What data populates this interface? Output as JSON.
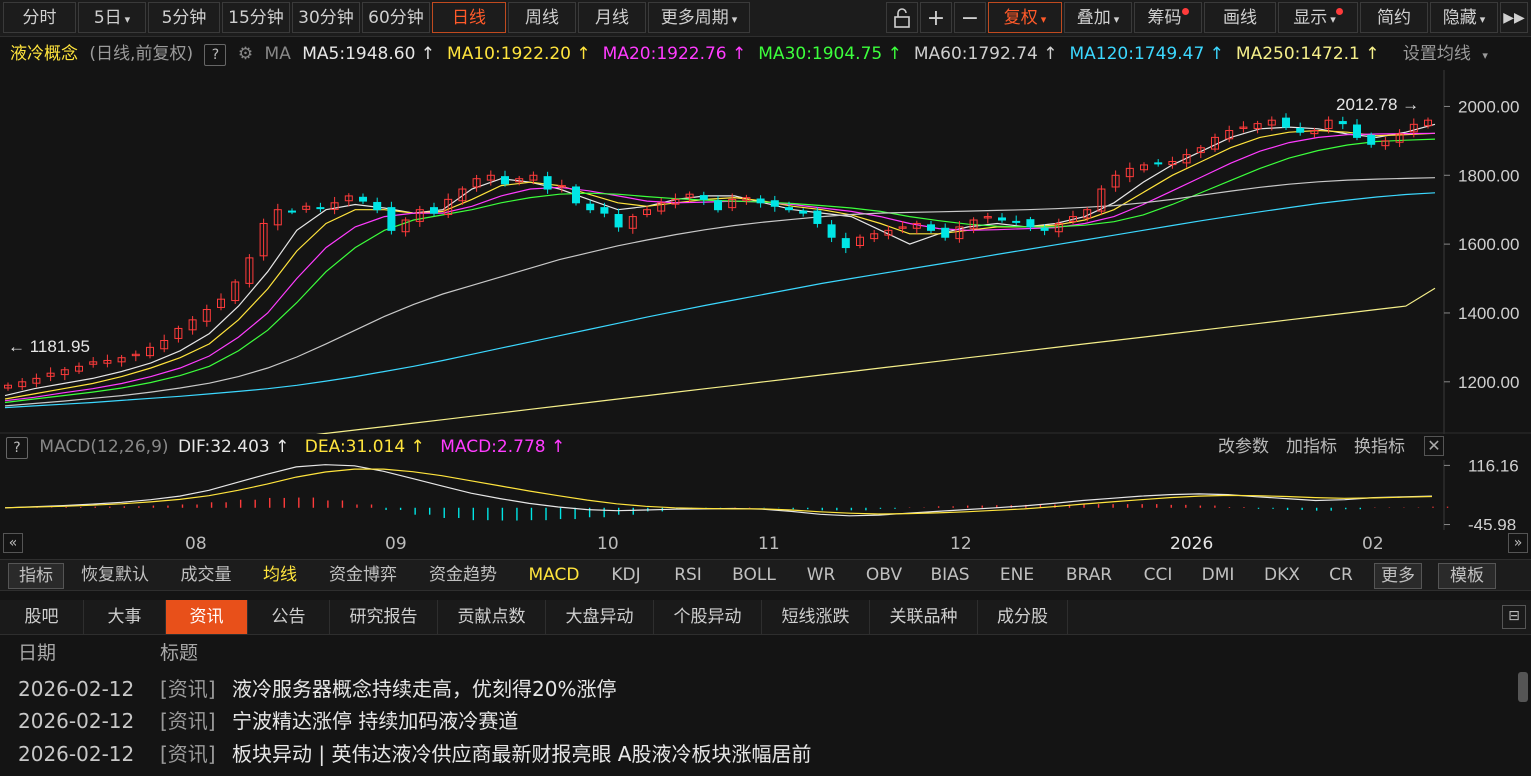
{
  "toolbar": {
    "periods": [
      "分时",
      "5日",
      "5分钟",
      "15分钟",
      "30分钟",
      "60分钟",
      "日线",
      "周线",
      "月线",
      "更多周期"
    ],
    "active_period": "日线",
    "tools": [
      "复权",
      "叠加",
      "筹码",
      "画线",
      "显示",
      "简约",
      "隐藏"
    ]
  },
  "ma_bar": {
    "name": "液冷概念",
    "mode": "(日线,前复权)",
    "help": "?",
    "ma_label": "MA",
    "items": [
      {
        "text": "MA5:1948.60",
        "color": "#e6e6e6"
      },
      {
        "text": "MA10:1922.20",
        "color": "#ffe43d"
      },
      {
        "text": "MA20:1922.76",
        "color": "#ff3cff"
      },
      {
        "text": "MA30:1904.75",
        "color": "#3cff3c"
      },
      {
        "text": "MA60:1792.74",
        "color": "#cfcfcf"
      },
      {
        "text": "MA120:1749.47",
        "color": "#3cd8ff"
      },
      {
        "text": "MA250:1472.1",
        "color": "#f5ef8a"
      }
    ],
    "settings": "设置均线"
  },
  "chart_data": {
    "type": "candlestick",
    "x_labels": [
      "08",
      "09",
      "10",
      "11",
      "12",
      "2026",
      "02"
    ],
    "y_ticks": [
      "2000.00",
      "1800.00",
      "1600.00",
      "1400.00",
      "1200.00"
    ],
    "ylim": [
      1060,
      2100
    ],
    "high_label": "2012.78",
    "low_label": "1181.95",
    "closes": [
      1190,
      1200,
      1210,
      1225,
      1235,
      1245,
      1258,
      1262,
      1270,
      1280,
      1300,
      1320,
      1355,
      1380,
      1410,
      1440,
      1490,
      1560,
      1660,
      1700,
      1695,
      1710,
      1705,
      1720,
      1740,
      1725,
      1700,
      1640,
      1670,
      1700,
      1690,
      1730,
      1760,
      1790,
      1800,
      1775,
      1790,
      1800,
      1760,
      1770,
      1720,
      1700,
      1690,
      1650,
      1680,
      1700,
      1720,
      1730,
      1745,
      1730,
      1700,
      1730,
      1735,
      1720,
      1710,
      1700,
      1690,
      1660,
      1620,
      1590,
      1620,
      1630,
      1640,
      1650,
      1660,
      1640,
      1620,
      1650,
      1670,
      1680,
      1670,
      1665,
      1650,
      1640,
      1660,
      1680,
      1700,
      1760,
      1800,
      1820,
      1830,
      1835,
      1840,
      1860,
      1880,
      1910,
      1930,
      1940,
      1950,
      1960,
      1940,
      1925,
      1930,
      1960,
      1950,
      1910,
      1890,
      1900,
      1920,
      1948,
      1960
    ],
    "ma": [
      {
        "name": "MA5",
        "color": "#e6e6e6",
        "values": [
          1160,
          1180,
          1195,
          1210,
          1230,
          1255,
          1290,
          1340,
          1420,
          1520,
          1640,
          1700,
          1715,
          1705,
          1690,
          1700,
          1760,
          1790,
          1780,
          1760,
          1730,
          1700,
          1710,
          1730,
          1740,
          1740,
          1720,
          1700,
          1690,
          1680,
          1640,
          1600,
          1630,
          1650,
          1660,
          1650,
          1660,
          1680,
          1720,
          1780,
          1830,
          1870,
          1910,
          1935,
          1940,
          1935,
          1920,
          1910,
          1925,
          1948
        ]
      },
      {
        "name": "MA10",
        "color": "#ffe43d",
        "values": [
          1150,
          1165,
          1180,
          1195,
          1215,
          1240,
          1270,
          1310,
          1380,
          1470,
          1580,
          1660,
          1700,
          1700,
          1690,
          1695,
          1730,
          1770,
          1780,
          1770,
          1745,
          1720,
          1710,
          1720,
          1730,
          1735,
          1725,
          1710,
          1700,
          1685,
          1660,
          1630,
          1630,
          1640,
          1650,
          1650,
          1655,
          1670,
          1700,
          1750,
          1800,
          1840,
          1880,
          1910,
          1925,
          1930,
          1925,
          1915,
          1918,
          1922
        ]
      },
      {
        "name": "MA20",
        "color": "#ff3cff",
        "values": [
          1145,
          1155,
          1168,
          1180,
          1195,
          1215,
          1240,
          1275,
          1330,
          1400,
          1500,
          1590,
          1650,
          1680,
          1690,
          1690,
          1710,
          1740,
          1760,
          1765,
          1755,
          1740,
          1725,
          1720,
          1722,
          1725,
          1722,
          1715,
          1705,
          1695,
          1680,
          1660,
          1645,
          1640,
          1642,
          1645,
          1648,
          1660,
          1680,
          1715,
          1755,
          1795,
          1835,
          1870,
          1895,
          1910,
          1918,
          1920,
          1921,
          1922
        ]
      },
      {
        "name": "MA30",
        "color": "#3cff3c",
        "values": [
          1140,
          1150,
          1160,
          1170,
          1182,
          1198,
          1218,
          1245,
          1290,
          1350,
          1430,
          1520,
          1590,
          1640,
          1670,
          1685,
          1700,
          1720,
          1735,
          1745,
          1748,
          1745,
          1738,
          1732,
          1728,
          1725,
          1722,
          1718,
          1712,
          1705,
          1695,
          1680,
          1668,
          1658,
          1652,
          1650,
          1650,
          1655,
          1665,
          1685,
          1715,
          1750,
          1785,
          1820,
          1850,
          1872,
          1888,
          1898,
          1902,
          1905
        ]
      },
      {
        "name": "MA60",
        "color": "#c8c8c8",
        "values": [
          1130,
          1137,
          1144,
          1152,
          1160,
          1170,
          1182,
          1196,
          1215,
          1240,
          1272,
          1310,
          1350,
          1390,
          1425,
          1455,
          1480,
          1505,
          1530,
          1555,
          1575,
          1595,
          1612,
          1628,
          1642,
          1654,
          1664,
          1672,
          1680,
          1686,
          1690,
          1692,
          1694,
          1696,
          1698,
          1700,
          1703,
          1707,
          1712,
          1720,
          1730,
          1742,
          1754,
          1765,
          1774,
          1781,
          1786,
          1789,
          1791,
          1793
        ]
      },
      {
        "name": "MA120",
        "color": "#3cd8ff",
        "values": [
          1125,
          1130,
          1135,
          1140,
          1146,
          1152,
          1158,
          1165,
          1172,
          1180,
          1190,
          1202,
          1215,
          1230,
          1245,
          1262,
          1280,
          1298,
          1316,
          1334,
          1352,
          1370,
          1388,
          1405,
          1422,
          1438,
          1454,
          1470,
          1486,
          1500,
          1514,
          1528,
          1542,
          1556,
          1570,
          1584,
          1598,
          1612,
          1626,
          1640,
          1654,
          1668,
          1681,
          1694,
          1706,
          1718,
          1728,
          1737,
          1744,
          1749
        ]
      },
      {
        "name": "MA250",
        "color": "#f5ef8a",
        "values": [
          940,
          950,
          960,
          970,
          980,
          990,
          1000,
          1010,
          1020,
          1030,
          1040,
          1050,
          1060,
          1070,
          1080,
          1090,
          1100,
          1110,
          1120,
          1130,
          1140,
          1150,
          1160,
          1170,
          1180,
          1190,
          1200,
          1210,
          1220,
          1230,
          1240,
          1250,
          1260,
          1270,
          1280,
          1290,
          1300,
          1310,
          1320,
          1330,
          1340,
          1350,
          1360,
          1370,
          1380,
          1390,
          1400,
          1410,
          1420,
          1472
        ]
      }
    ],
    "macd": {
      "label": "MACD(12,26,9)",
      "dif": "DIF:32.403",
      "dea": "DEA:31.014",
      "macd": "MACD:2.778",
      "ticks": [
        "116.16",
        "-45.98"
      ],
      "ylim": [
        -50,
        120
      ],
      "dif_values": [
        0,
        3,
        6,
        10,
        15,
        22,
        32,
        48,
        70,
        92,
        112,
        118,
        115,
        100,
        80,
        60,
        40,
        25,
        12,
        2,
        -5,
        -8,
        -6,
        -4,
        -3,
        -2,
        -4,
        -10,
        -18,
        -22,
        -20,
        -15,
        -10,
        -5,
        0,
        5,
        12,
        20,
        26,
        32,
        36,
        38,
        36,
        30,
        25,
        20,
        22,
        28,
        30,
        32
      ],
      "dea_values": [
        0,
        2,
        4,
        7,
        11,
        16,
        23,
        33,
        48,
        65,
        84,
        98,
        106,
        106,
        99,
        88,
        74,
        60,
        46,
        33,
        21,
        11,
        4,
        0,
        -2,
        -3,
        -3,
        -6,
        -11,
        -15,
        -17,
        -16,
        -14,
        -11,
        -7,
        -3,
        3,
        10,
        16,
        22,
        28,
        32,
        34,
        33,
        31,
        28,
        26,
        27,
        29,
        31
      ],
      "hist": [
        0,
        1,
        2,
        3,
        4,
        6,
        9,
        15,
        22,
        27,
        28,
        20,
        9,
        -6,
        -19,
        -28,
        -34,
        -35,
        -34,
        -31,
        -26,
        -19,
        -10,
        -4,
        -1,
        1,
        -1,
        -4,
        -7,
        -7,
        -3,
        1,
        4,
        6,
        7,
        8,
        9,
        10,
        10,
        10,
        8,
        6,
        2,
        -3,
        -6,
        -8,
        -4,
        1,
        1,
        3
      ]
    }
  },
  "macd_links": [
    "改参数",
    "加指标",
    "换指标"
  ],
  "indicators": {
    "items": [
      "指标",
      "恢复默认",
      "成交量",
      "均线",
      "资金博弈",
      "资金趋势",
      "MACD",
      "KDJ",
      "RSI",
      "BOLL",
      "WR",
      "OBV",
      "BIAS",
      "ENE",
      "BRAR",
      "CCI",
      "DMI",
      "DKX",
      "CR",
      "更多",
      "模板"
    ],
    "highlight": "均线"
  },
  "news_tabs": {
    "items": [
      "股吧",
      "大事",
      "资讯",
      "公告",
      "研究报告",
      "贡献点数",
      "大盘异动",
      "个股异动",
      "短线涨跌",
      "关联品种",
      "成分股"
    ],
    "active": "资讯"
  },
  "news": {
    "col_date": "日期",
    "col_title": "标题",
    "rows": [
      {
        "date": "2026-02-12",
        "tag": "[资讯]",
        "title": "液冷服务器概念持续走高，优刻得20%涨停"
      },
      {
        "date": "2026-02-12",
        "tag": "[资讯]",
        "title": "宁波精达涨停 持续加码液冷赛道"
      },
      {
        "date": "2026-02-12",
        "tag": "[资讯]",
        "title": "板块异动 | 英伟达液冷供应商最新财报亮眼 A股液冷板块涨幅居前"
      }
    ]
  },
  "colors": {
    "up": "#ff3b3b",
    "down": "#00e5e5",
    "accent": "#e8501a"
  }
}
